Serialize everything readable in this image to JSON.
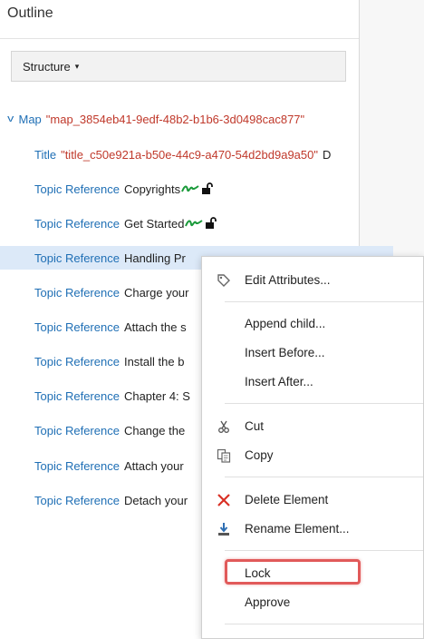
{
  "panel": {
    "title": "Outline",
    "structure_label": "Structure",
    "structure_caret": "▾"
  },
  "tree": {
    "map": {
      "tag": "Map",
      "attr": "\"map_3854eb41-9edf-48b2-b1b6-3d0498cac877\""
    },
    "title": {
      "tag": "Title",
      "attr": "\"title_c50e921a-b50e-44c9-a470-54d2bd9a9a50\"",
      "text": "D"
    },
    "rows": [
      {
        "tag": "Topic Reference",
        "text": "Copyrights"
      },
      {
        "tag": "Topic Reference",
        "text": "Get Started"
      },
      {
        "tag": "Topic Reference",
        "text": "Handling Pr"
      },
      {
        "tag": "Topic Reference",
        "text": "Charge your"
      },
      {
        "tag": "Topic Reference",
        "text": "Attach the s"
      },
      {
        "tag": "Topic Reference",
        "text": "Install the b"
      },
      {
        "tag": "Topic Reference",
        "text": "Chapter 4: S"
      },
      {
        "tag": "Topic Reference",
        "text": "Change the"
      },
      {
        "tag": "Topic Reference",
        "text": "Attach your"
      },
      {
        "tag": "Topic Reference",
        "text": "Detach your"
      }
    ]
  },
  "context_menu": {
    "edit_attributes": "Edit Attributes...",
    "append_child": "Append child...",
    "insert_before": "Insert Before...",
    "insert_after": "Insert After...",
    "cut": "Cut",
    "copy": "Copy",
    "delete_element": "Delete Element",
    "rename_element": "Rename Element...",
    "lock": "Lock",
    "approve": "Approve"
  }
}
